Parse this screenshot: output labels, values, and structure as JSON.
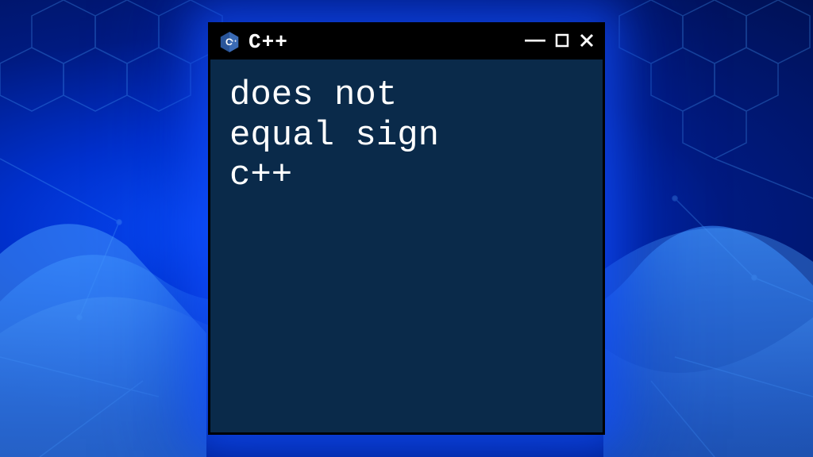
{
  "window": {
    "title": "C++",
    "icon": "cpp-hex-icon",
    "controls": {
      "minimize": "—",
      "maximize": "☐",
      "close": "✕"
    }
  },
  "content": {
    "text": "does not\nequal sign\nc++"
  },
  "colors": {
    "window_bg": "#0a2a4a",
    "titlebar_bg": "#000000",
    "text": "#ffffff",
    "glow": "#1050ff"
  }
}
